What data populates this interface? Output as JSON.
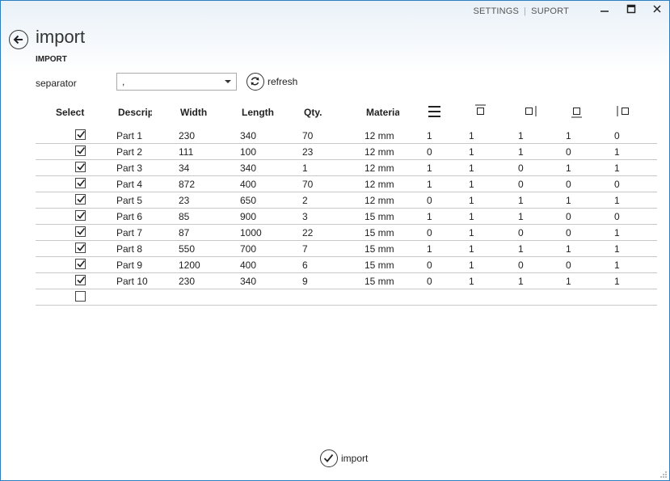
{
  "window": {
    "menu": [
      {
        "label": "SETTINGS"
      },
      {
        "label": "SUPORT"
      }
    ],
    "controls": {
      "minimize": "—",
      "maximize": "☐",
      "close": "✕"
    }
  },
  "header": {
    "title": "import",
    "section": "IMPORT"
  },
  "toolbar": {
    "separator_label": "separator",
    "separator_value": ",",
    "refresh_label": "refresh"
  },
  "table": {
    "columns": {
      "select": "Select",
      "description": "Description",
      "width": "Width",
      "length": "Length",
      "qty": "Qty.",
      "material": "Material"
    },
    "icon_columns": [
      "grain-direction-icon",
      "edge-top-icon",
      "edge-right-icon",
      "edge-bottom-icon",
      "edge-left-icon"
    ],
    "rows": [
      {
        "checked": true,
        "desc": "Part 1",
        "width": "230",
        "length": "340",
        "qty": "70",
        "material": "12 mm",
        "e1": "1",
        "e2": "1",
        "e3": "1",
        "e4": "1",
        "e5": "0"
      },
      {
        "checked": true,
        "desc": "Part 2",
        "width": "111",
        "length": "100",
        "qty": "23",
        "material": "12 mm",
        "e1": "0",
        "e2": "1",
        "e3": "1",
        "e4": "0",
        "e5": "1"
      },
      {
        "checked": true,
        "desc": "Part 3",
        "width": "34",
        "length": "340",
        "qty": "1",
        "material": "12 mm",
        "e1": "1",
        "e2": "1",
        "e3": "0",
        "e4": "1",
        "e5": "1"
      },
      {
        "checked": true,
        "desc": "Part 4",
        "width": "872",
        "length": "400",
        "qty": "70",
        "material": "12 mm",
        "e1": "1",
        "e2": "1",
        "e3": "0",
        "e4": "0",
        "e5": "0"
      },
      {
        "checked": true,
        "desc": "Part 5",
        "width": "23",
        "length": "650",
        "qty": "2",
        "material": "12 mm",
        "e1": "0",
        "e2": "1",
        "e3": "1",
        "e4": "1",
        "e5": "1"
      },
      {
        "checked": true,
        "desc": "Part 6",
        "width": "85",
        "length": "900",
        "qty": "3",
        "material": "15 mm",
        "e1": "1",
        "e2": "1",
        "e3": "1",
        "e4": "0",
        "e5": "0"
      },
      {
        "checked": true,
        "desc": "Part 7",
        "width": "87",
        "length": "1000",
        "qty": "22",
        "material": "15 mm",
        "e1": "0",
        "e2": "1",
        "e3": "0",
        "e4": "0",
        "e5": "1"
      },
      {
        "checked": true,
        "desc": "Part 8",
        "width": "550",
        "length": "700",
        "qty": "7",
        "material": "15 mm",
        "e1": "1",
        "e2": "1",
        "e3": "1",
        "e4": "1",
        "e5": "1"
      },
      {
        "checked": true,
        "desc": "Part 9",
        "width": "1200",
        "length": "400",
        "qty": "6",
        "material": "15 mm",
        "e1": "0",
        "e2": "1",
        "e3": "0",
        "e4": "0",
        "e5": "1"
      },
      {
        "checked": true,
        "desc": "Part 10",
        "width": "230",
        "length": "340",
        "qty": "9",
        "material": "15 mm",
        "e1": "0",
        "e2": "1",
        "e3": "1",
        "e4": "1",
        "e5": "1"
      },
      {
        "checked": false,
        "desc": "",
        "width": "",
        "length": "",
        "qty": "",
        "material": "",
        "e1": "",
        "e2": "",
        "e3": "",
        "e4": "",
        "e5": ""
      }
    ]
  },
  "footer": {
    "import_label": "import"
  }
}
